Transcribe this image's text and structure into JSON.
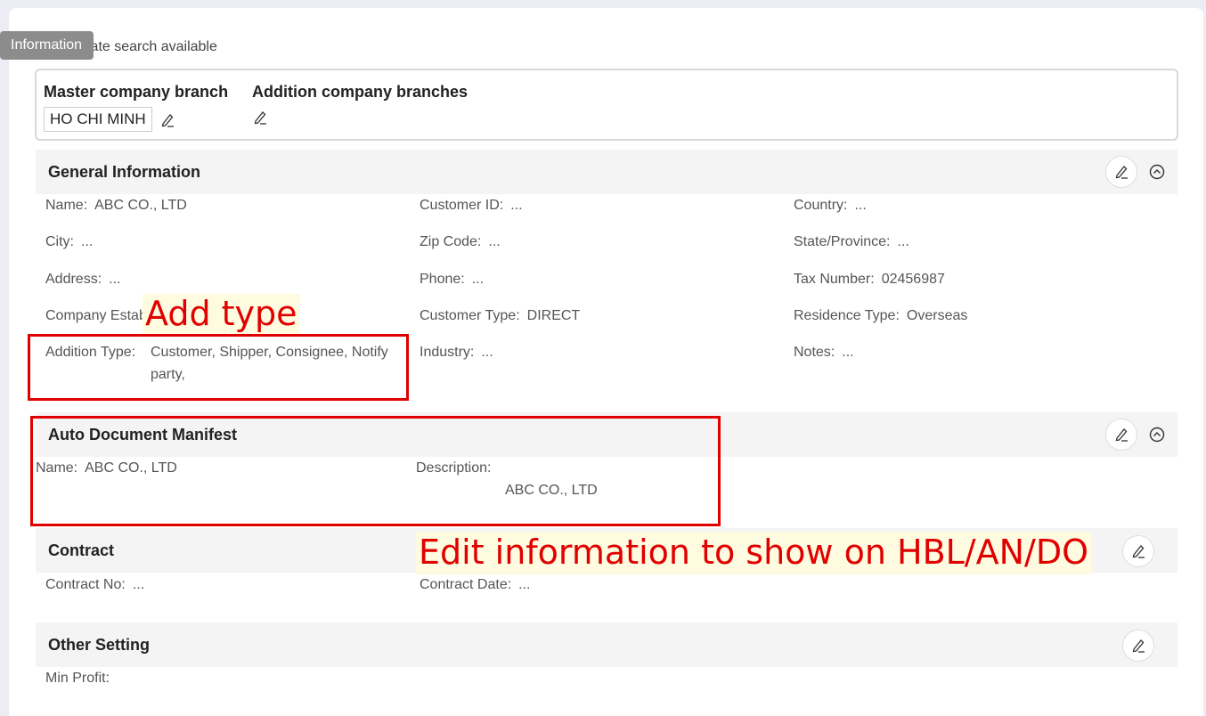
{
  "tooltip": "Information",
  "rate_search": {
    "label": "Rate search available"
  },
  "branches": {
    "master_title": "Master company branch",
    "master_value": "HO CHI MINH",
    "addition_title": "Addition company branches"
  },
  "general": {
    "title": "General Information",
    "name_label": "Name:",
    "name_value": "ABC CO., LTD",
    "customer_id_label": "Customer ID:",
    "customer_id_value": "...",
    "country_label": "Country:",
    "country_value": "...",
    "city_label": "City:",
    "city_value": "...",
    "zip_label": "Zip Code:",
    "zip_value": "...",
    "state_label": "State/Province:",
    "state_value": "...",
    "address_label": "Address:",
    "address_value": "...",
    "phone_label": "Phone:",
    "phone_value": "...",
    "tax_label": "Tax Number:",
    "tax_value": "02456987",
    "est_label": "Company Establishment Date:",
    "est_value": "...",
    "cust_type_label": "Customer Type:",
    "cust_type_value": "DIRECT",
    "res_type_label": "Residence Type:",
    "res_type_value": "Overseas",
    "add_type_label": "Addition Type:",
    "add_type_value_1": "Customer, Shipper, Consignee, Notify",
    "add_type_value_2": "party,",
    "industry_label": "Industry:",
    "industry_value": "...",
    "notes_label": "Notes:",
    "notes_value": "..."
  },
  "manifest": {
    "title": "Auto Document Manifest",
    "name_label": "Name:",
    "name_value": "ABC CO., LTD",
    "desc_label": "Description:",
    "desc_value": "ABC CO., LTD"
  },
  "contract": {
    "title": "Contract",
    "no_label": "Contract No:",
    "no_value": "...",
    "date_label": "Contract Date:",
    "date_value": "..."
  },
  "other": {
    "title": "Other Setting",
    "min_profit_label": "Min Profit:"
  },
  "annotations": {
    "add_type": "Add type",
    "edit_info": "Edit information to show on HBL/AN/DO"
  },
  "colors": {
    "highlight": "#e00000",
    "annotation_bg": "#fffbe0"
  }
}
